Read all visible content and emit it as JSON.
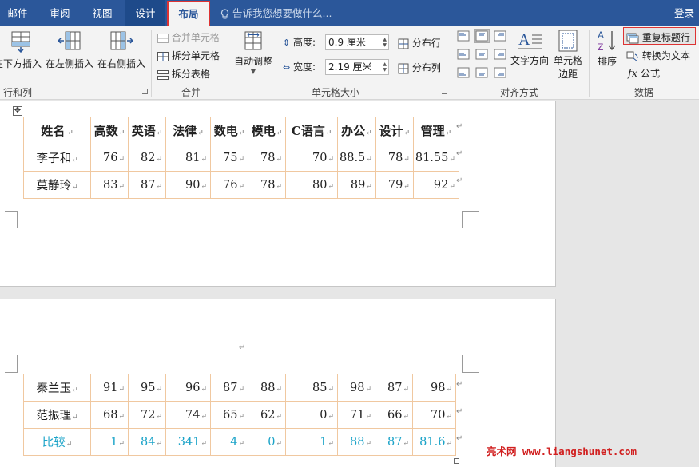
{
  "tabs": {
    "mail": "邮件",
    "review": "审阅",
    "view": "视图",
    "design": "设计",
    "layout": "布局",
    "tell_me": "告诉我您想要做什么...",
    "login": "登录"
  },
  "ribbon": {
    "rows_cols": {
      "insert_below": "在下方插入",
      "insert_left": "在左侧插入",
      "insert_right": "在右侧插入",
      "group_label": "行和列"
    },
    "merge": {
      "merge_cells": "合并单元格",
      "split_cells": "拆分单元格",
      "split_table": "拆分表格",
      "group_label": "合并"
    },
    "cell_size": {
      "autofit": "自动调整",
      "height_label": "高度:",
      "height_value": "0.9 厘米",
      "width_label": "宽度:",
      "width_value": "2.19 厘米",
      "distribute_rows": "分布行",
      "distribute_cols": "分布列",
      "group_label": "单元格大小"
    },
    "alignment": {
      "text_direction": "文字方向",
      "cell_margins_1": "单元格",
      "cell_margins_2": "边距",
      "group_label": "对齐方式"
    },
    "data": {
      "sort": "排序",
      "repeat_header": "重复标题行",
      "convert_text": "转换为文本",
      "formula": "公式",
      "group_label": "数据"
    }
  },
  "table_top": {
    "headers": [
      "姓名",
      "高数",
      "英语",
      "法律",
      "数电",
      "模电",
      "C语言",
      "办公",
      "设计",
      "管理"
    ],
    "rows": [
      [
        "李子和",
        "76",
        "82",
        "81",
        "75",
        "78",
        "70",
        "88.5",
        "78",
        "81.55"
      ],
      [
        "莫静玲",
        "83",
        "87",
        "90",
        "76",
        "78",
        "80",
        "89",
        "79",
        "92"
      ]
    ]
  },
  "table_bottom": {
    "rows": [
      [
        "秦兰玉",
        "91",
        "95",
        "96",
        "87",
        "88",
        "85",
        "98",
        "87",
        "98"
      ],
      [
        "范振理",
        "68",
        "72",
        "74",
        "65",
        "62",
        "0",
        "71",
        "66",
        "70"
      ],
      [
        "比较",
        "1",
        "84",
        "341",
        "4",
        "0",
        "1",
        "88",
        "87",
        "81.6"
      ]
    ]
  },
  "paragraph_mark": "↵",
  "watermark": "亮术网 www.liangshunet.com",
  "colors": {
    "tab_bar": "#2b579a",
    "highlight_border": "#d33333",
    "compare_row_text": "#1aa3c8",
    "cell_border": "#f0c8a0"
  }
}
